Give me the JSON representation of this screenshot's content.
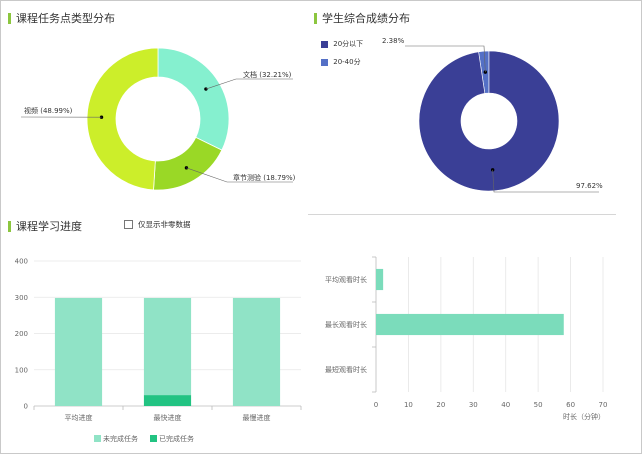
{
  "panels": {
    "task_types": {
      "title": "课程任务点类型分布"
    },
    "score_dist": {
      "title": "学生综合成绩分布"
    },
    "progress": {
      "title": "课程学习进度",
      "checkbox_label": "仅显示非零数据"
    }
  },
  "colors": {
    "accent_bar": "#8cc63f",
    "video": "#ccee2a",
    "document": "#85f0cf",
    "chapter_test": "#9ad826",
    "score_low": "#3a3f96",
    "score_mid": "#5470c6",
    "unfinished": "#90e3c6",
    "finished": "#22c382"
  },
  "chart_data": [
    {
      "type": "pie",
      "name": "course_task_types",
      "slices": [
        {
          "label": "视频 (48.99%)",
          "value": 48.99
        },
        {
          "label": "文档 (32.21%)",
          "value": 32.21
        },
        {
          "label": "章节测验 (18.79%)",
          "value": 18.79
        }
      ]
    },
    {
      "type": "pie",
      "name": "student_score_distribution",
      "legend": [
        "20分以下",
        "20-40分"
      ],
      "slices": [
        {
          "label": "97.62%",
          "value": 97.62,
          "series": "20分以下"
        },
        {
          "label": "2.38%",
          "value": 2.38,
          "series": "20-40分"
        }
      ]
    },
    {
      "type": "bar",
      "name": "learning_progress",
      "stacked": true,
      "categories": [
        "平均进度",
        "最快进度",
        "最慢进度"
      ],
      "series": [
        {
          "name": "未完成任务",
          "values": [
            298,
            268,
            298
          ]
        },
        {
          "name": "已完成任务",
          "values": [
            0,
            30,
            0
          ]
        }
      ],
      "yticks": [
        "0",
        "100",
        "200",
        "300",
        "400"
      ],
      "ylim": [
        0,
        400
      ]
    },
    {
      "type": "bar",
      "name": "watch_duration",
      "orientation": "horizontal",
      "categories": [
        "平均观看时长",
        "最长观看时长",
        "最短观看时长"
      ],
      "values": [
        2.2,
        57.9,
        0
      ],
      "xticks": [
        "0",
        "10",
        "20",
        "30",
        "40",
        "50",
        "60",
        "70"
      ],
      "xlim": [
        0,
        70
      ],
      "xlabel": "时长（分钟）"
    }
  ]
}
